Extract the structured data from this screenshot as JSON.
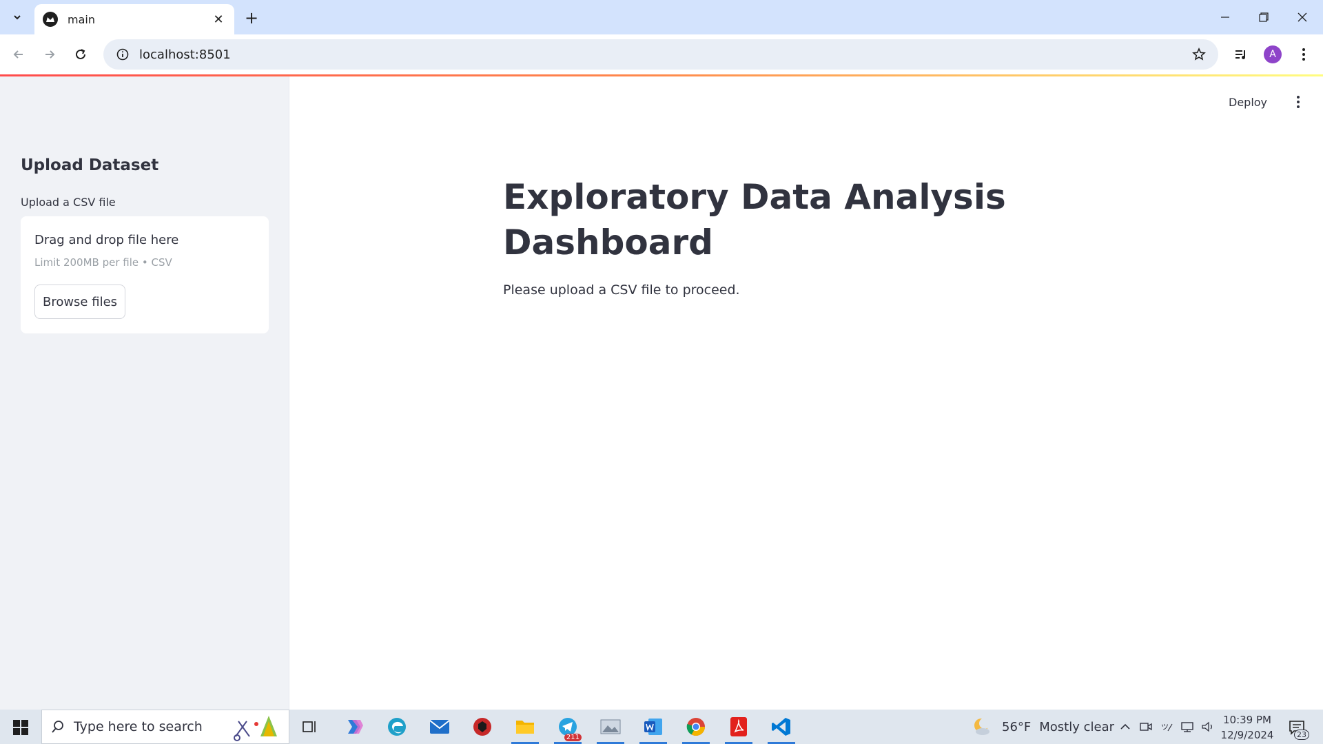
{
  "browser": {
    "tab_title": "main",
    "url": "localhost:8501",
    "avatar_initial": "A"
  },
  "sidebar": {
    "heading": "Upload Dataset",
    "uploader_label": "Upload a CSV file",
    "dropzone_title": "Drag and drop file here",
    "dropzone_limit": "Limit 200MB per file • CSV",
    "browse_label": "Browse files"
  },
  "main": {
    "deploy_label": "Deploy",
    "title": "Exploratory Data Analysis Dashboard",
    "info": "Please upload a CSV file to proceed."
  },
  "taskbar": {
    "search_placeholder": "Type here to search",
    "telegram_badge": "211",
    "weather_temp": "56°F",
    "weather_desc": "Mostly clear",
    "time": "10:39 PM",
    "date": "12/9/2024",
    "notification_count": "23"
  },
  "colors": {
    "tabstrip": "#d3e3fd",
    "sidebar": "#f0f2f6",
    "streamlit_accent": "#ff4b4b",
    "taskbar": "#dfe6ee"
  }
}
